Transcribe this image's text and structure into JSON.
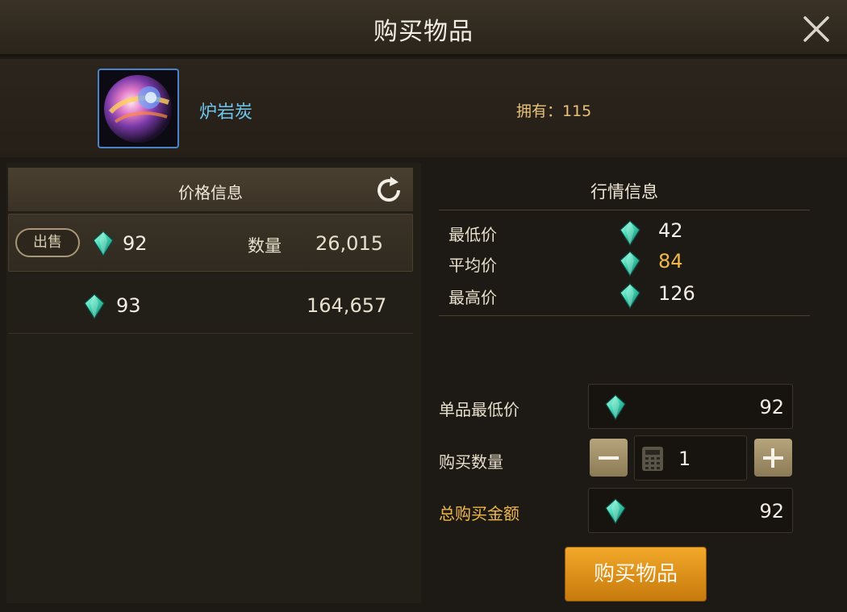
{
  "dialog": {
    "title": "购买物品"
  },
  "item": {
    "name": "炉岩炭",
    "owned": "拥有：115"
  },
  "price_panel": {
    "header": "价格信息",
    "rows": [
      {
        "badge": "出售",
        "price": "92",
        "qty_label": "数量",
        "qty": "26,015"
      },
      {
        "price": "93",
        "qty": "164,657"
      }
    ]
  },
  "market": {
    "title": "行情信息",
    "rows": [
      {
        "label": "最低价",
        "value": "42"
      },
      {
        "label": "平均价",
        "value": "84"
      },
      {
        "label": "最高价",
        "value": "126"
      }
    ]
  },
  "form": {
    "unit_min_label": "单品最低价",
    "unit_min_value": "92",
    "qty_label": "购买数量",
    "qty_value": "1",
    "total_label": "总购买金额",
    "total_value": "92"
  },
  "buy_button": "购买物品",
  "colors": {
    "accent_gold": "#f0b84a",
    "item_name": "#6ec6ee",
    "button": "#e49a1c",
    "currency_gem": "#3fd6b0"
  },
  "icons": [
    "close-icon",
    "refresh-icon",
    "gem-icon",
    "calculator-icon",
    "minus-icon",
    "plus-icon"
  ]
}
